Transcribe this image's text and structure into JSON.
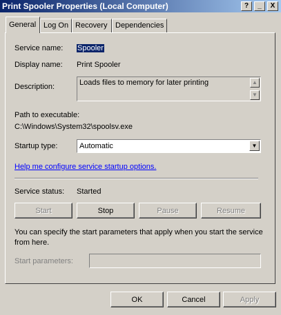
{
  "window": {
    "title": "Print Spooler Properties (Local Computer)",
    "controls": {
      "help": "?",
      "minimize": "_",
      "close": "X"
    }
  },
  "tabs": [
    {
      "label": "General",
      "active": true
    },
    {
      "label": "Log On",
      "active": false
    },
    {
      "label": "Recovery",
      "active": false
    },
    {
      "label": "Dependencies",
      "active": false
    }
  ],
  "general": {
    "service_name_label": "Service name:",
    "service_name_value": "Spooler",
    "display_name_label": "Display name:",
    "display_name_value": "Print Spooler",
    "description_label": "Description:",
    "description_value": "Loads files to memory for later printing",
    "path_label": "Path to executable:",
    "path_value": "C:\\Windows\\System32\\spoolsv.exe",
    "startup_type_label": "Startup type:",
    "startup_type_value": "Automatic",
    "help_link": "Help me configure service startup options.",
    "service_status_label": "Service status:",
    "service_status_value": "Started",
    "buttons": {
      "start": "Start",
      "stop": "Stop",
      "pause": "Pause",
      "resume": "Resume"
    },
    "note": "You can specify the start parameters that apply when you start the service from here.",
    "start_params_label": "Start parameters:",
    "start_params_value": ""
  },
  "footer": {
    "ok": "OK",
    "cancel": "Cancel",
    "apply": "Apply"
  },
  "icons": {
    "scroll_up": "scroll-up-arrow-icon",
    "scroll_down": "scroll-down-arrow-icon",
    "dropdown": "chevron-down-icon"
  }
}
